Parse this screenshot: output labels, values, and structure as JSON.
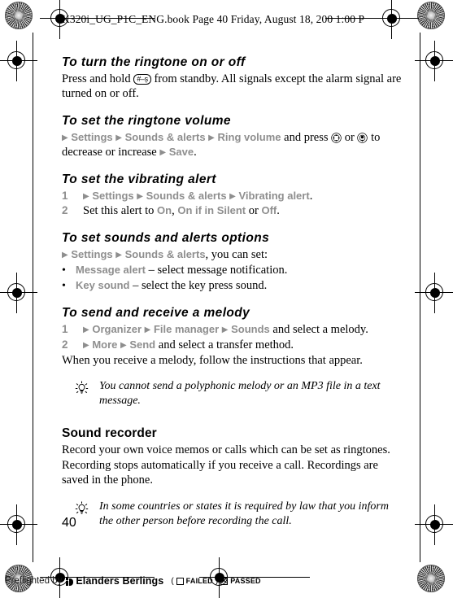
{
  "header": {
    "running_head": "K320i_UG_P1C_ENG.book  Page 40  Friday, August 18, 200   1:00 P"
  },
  "sections": [
    {
      "id": "ringtone-on-off",
      "heading": "To turn the ringtone on or off",
      "body_before_key": "Press and hold ",
      "key_glyph": "#–ș",
      "body_after_key": " from standby. All signals except the alarm signal are turned on or off."
    },
    {
      "id": "ringtone-volume",
      "heading": "To set the ringtone volume",
      "menu_1": "Settings",
      "menu_2": "Sounds & alerts",
      "menu_3": "Ring volume",
      "text_mid": " and press ",
      "text_or": " or ",
      "text_tail": " to decrease or increase ",
      "menu_4": "Save",
      "text_end": "."
    },
    {
      "id": "vibrating-alert",
      "heading": "To set the vibrating alert",
      "steps": [
        {
          "num": "1",
          "menu_1": "Settings",
          "menu_2": "Sounds & alerts",
          "menu_3": "Vibrating alert",
          "tail": "."
        },
        {
          "num": "2",
          "lead": "Set this alert to ",
          "opt_1": "On",
          "sep_1": ", ",
          "opt_2": "On if in Silent",
          "sep_2": " or ",
          "opt_3": "Off",
          "tail": "."
        }
      ]
    },
    {
      "id": "sounds-alerts-options",
      "heading": "To set sounds and alerts options",
      "menu_1": "Settings",
      "menu_2": "Sounds & alerts",
      "intro_tail": ", you can set:",
      "bullets": [
        {
          "dot": "•",
          "term": "Message alert",
          "desc": " – select message notification."
        },
        {
          "dot": "•",
          "term": "Key sound",
          "desc": " – select the key press sound."
        }
      ]
    },
    {
      "id": "send-receive-melody",
      "heading": "To send and receive a melody",
      "steps": [
        {
          "num": "1",
          "menu_1": "Organizer",
          "menu_2": "File manager",
          "menu_3": "Sounds",
          "tail": " and select a melody."
        },
        {
          "num": "2",
          "menu_1": "More",
          "menu_2": "Send",
          "tail": " and select a transfer method."
        }
      ],
      "closing": "When you receive a melody, follow the instructions that appear."
    },
    {
      "id": "sound-recorder",
      "heading": "Sound recorder",
      "body": "Record your own voice memos or calls which can be set as ringtones. Recording stops automatically if you receive a call. Recordings are saved in the phone."
    }
  ],
  "notes": [
    {
      "id": "note-melody",
      "icon": "lightbulb-icon",
      "text": "You cannot send a polyphonic melody or an MP3 file in a text message."
    },
    {
      "id": "note-recording-law",
      "icon": "lightbulb-icon",
      "text": "In some countries or states it is required by law that you inform the other person before recording the call."
    }
  ],
  "footer": {
    "page_number": "40",
    "preflight_label": "Preflighted by",
    "company": "Elanders Berlings",
    "paren_open": "(",
    "failed_label": "FAILED",
    "paren_close": ")",
    "passed_label": "PASSED"
  },
  "colors": {
    "menu_gray": "#8e8e8e",
    "text_black": "#000000",
    "page_background": "#ffffff"
  }
}
